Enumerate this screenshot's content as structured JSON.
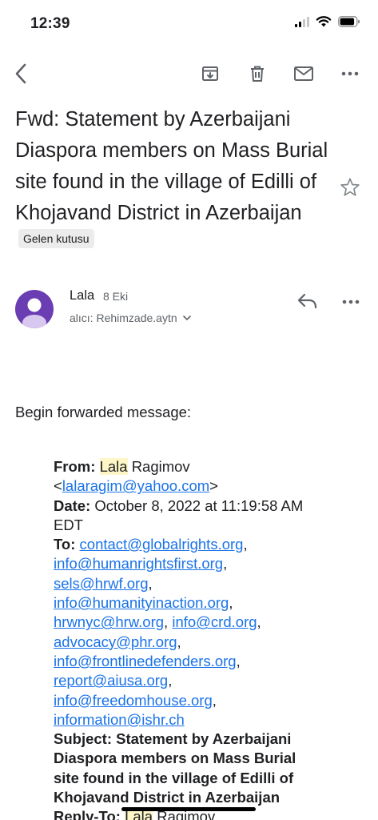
{
  "status": {
    "time": "12:39"
  },
  "toolbar": {
    "icons": [
      "back-icon",
      "archive-icon",
      "trash-icon",
      "mail-icon",
      "more-icon"
    ]
  },
  "email": {
    "subject": "Fwd: Statement by Azerbaijani Diaspora members on Mass Burial site found in the village of Edilli of Khojavand District in Azerbaijan",
    "label": "Gelen kutusu",
    "sender": {
      "name": "Lala",
      "date": "8 Eki",
      "recipient": "alıcı: Rehimzade.aytn"
    },
    "accent_color": "#6a3db3"
  },
  "body": {
    "intro": "Begin forwarded message:",
    "from_label": "From:",
    "from_name_first": "Lala",
    "from_name_last": "Ragimov",
    "from_email": "lalaragim@yahoo.com",
    "date_label": "Date:",
    "date_value": "October 8, 2022 at 11:19:58 AM EDT",
    "to_label": "To:",
    "to_list": [
      "contact@globalrights.org",
      "info@humanrightsfirst.org",
      "sels@hrwf.org",
      "info@humanityinaction.org",
      "hrwnyc@hrw.org",
      "info@crd.org",
      "advocacy@phr.org",
      "info@frontlinedefenders.org",
      "report@aiusa.org",
      "info@freedomhouse.org",
      "information@ishr.ch"
    ],
    "subject_label": "Subject:",
    "subject_value": "Statement by Azerbaijani Diaspora members on Mass Burial site found in the village of Edilli of Khojavand District in Azerbaijan",
    "replyto_label": "Reply-To:",
    "replyto_first": "Lala",
    "replyto_last": "Ragimov"
  }
}
